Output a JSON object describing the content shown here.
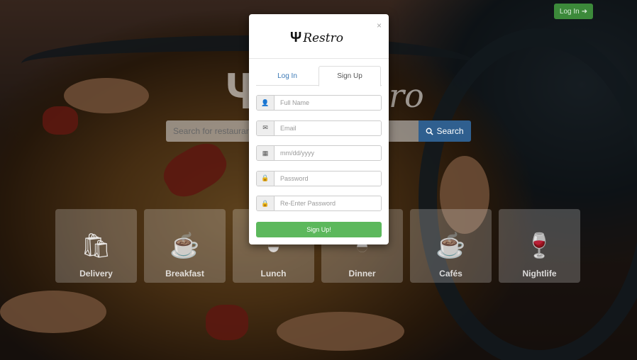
{
  "header": {
    "login_label": "Log In",
    "login_icon": "sign-in-icon"
  },
  "hero": {
    "search_placeholder": "Search for restaurants...",
    "search_button_label": "Search"
  },
  "categories": [
    {
      "label": "Delivery",
      "icon": "delivery-icon"
    },
    {
      "label": "Breakfast",
      "icon": "breakfast-icon"
    },
    {
      "label": "Lunch",
      "icon": "lunch-icon"
    },
    {
      "label": "Dinner",
      "icon": "dinner-icon"
    },
    {
      "label": "Cafés",
      "icon": "cafe-icon"
    },
    {
      "label": "Nightlife",
      "icon": "nightlife-icon"
    }
  ],
  "modal": {
    "brand": "Restro",
    "close_symbol": "×",
    "tabs": [
      {
        "label": "Log In",
        "active": false
      },
      {
        "label": "Sign Up",
        "active": true
      }
    ],
    "fields": [
      {
        "placeholder": "Full Name",
        "icon": "user-icon"
      },
      {
        "placeholder": "Email",
        "icon": "envelope-icon"
      },
      {
        "placeholder": "mm/dd/yyyy",
        "icon": "calendar-icon"
      },
      {
        "placeholder": "Password",
        "icon": "lock-icon"
      },
      {
        "placeholder": "Re-Enter Password",
        "icon": "lock-icon"
      }
    ],
    "submit_label": "Sign Up!"
  },
  "colors": {
    "primary_green": "#5cb85c",
    "search_blue": "#2f5f8f",
    "link_blue": "#3a78b5"
  }
}
